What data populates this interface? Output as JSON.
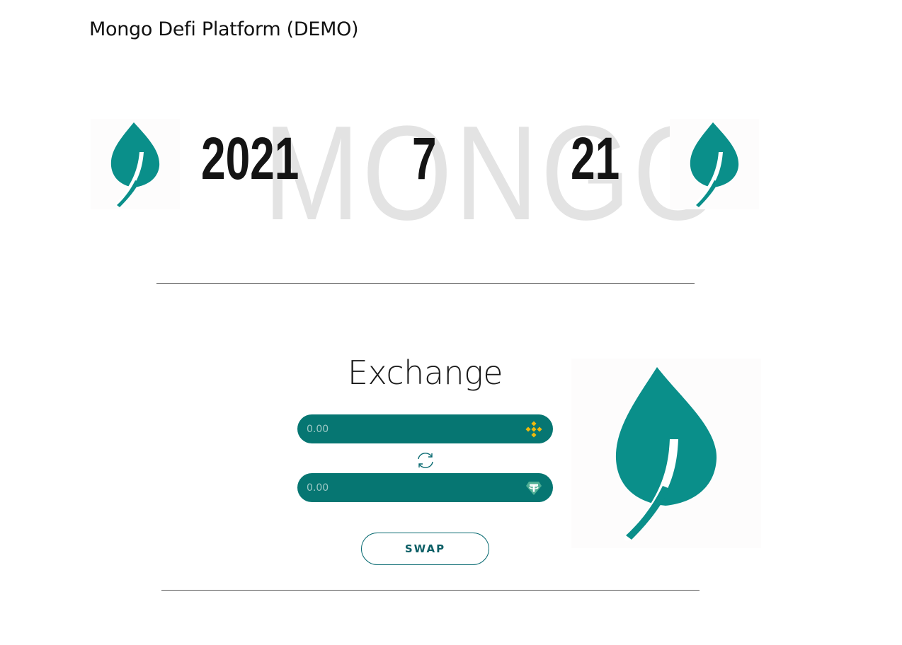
{
  "header": {
    "title": "Mongo Defi Platform (DEMO)"
  },
  "hero": {
    "watermark": "MONGO",
    "date": {
      "year": "2021",
      "month": "7",
      "day": "21"
    }
  },
  "exchange": {
    "title": "Exchange",
    "from": {
      "placeholder": "0.00",
      "token_icon": "bnb-icon"
    },
    "to": {
      "placeholder": "0.00",
      "token_icon": "tether-icon"
    },
    "swap_direction_icon": "swap-arrows-icon",
    "swap_label": "SWAP"
  },
  "colors": {
    "brand_teal": "#067672",
    "leaf_teal": "#0a8f8a",
    "swap_border": "#0a6b72",
    "bnb_yellow": "#f0b90b",
    "tether_green": "#50af95"
  }
}
